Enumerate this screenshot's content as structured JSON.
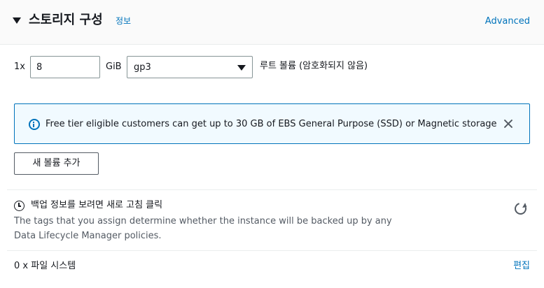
{
  "header": {
    "title": "스토리지 구성",
    "info_link": "정보",
    "advanced_link": "Advanced"
  },
  "volume": {
    "multiplier": "1x",
    "size_value": "8",
    "size_unit": "GiB",
    "type_value": "gp3",
    "root_label": "루트 볼륨  (암호화되지 않음)"
  },
  "alert": {
    "icon": "info-icon",
    "text": "Free tier eligible customers can get up to 30 GB of EBS General Purpose (SSD) or Magnetic storage",
    "close_icon": "close-icon",
    "color": "#0073bb",
    "background": "#f1faff"
  },
  "add_volume_button": "새 볼륨 추가",
  "backup": {
    "icon": "clock-icon",
    "title": "백업 정보를 보려면 새로 고침 클릭",
    "description": "The tags that you assign determine whether the instance will be backed up by any Data Lifecycle Manager policies.",
    "refresh_icon": "refresh-icon"
  },
  "file_systems": {
    "label": "0 x 파일 시스템",
    "edit_link": "편집"
  },
  "colors": {
    "link": "#0073bb",
    "text": "#16191f",
    "secondary_text": "#545b64",
    "header_bg": "#fafafa"
  }
}
